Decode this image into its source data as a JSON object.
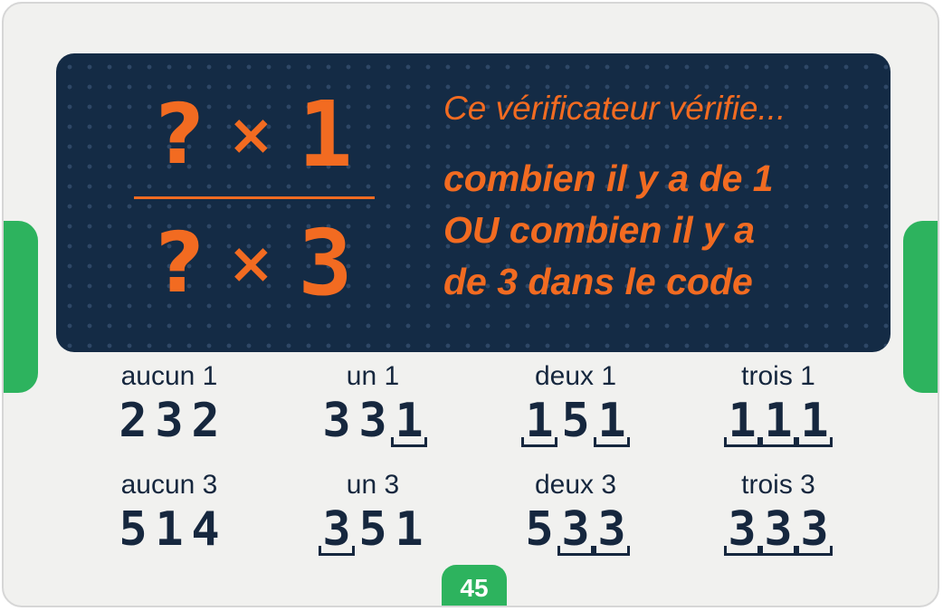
{
  "fraction": {
    "top": {
      "unknown": "?",
      "op": "×",
      "digit": "1"
    },
    "bottom": {
      "unknown": "?",
      "op": "×",
      "digit": "3"
    }
  },
  "header": {
    "intro": "Ce vérificateur vérifie...",
    "line1": "combien il y a de 1",
    "line2": "OU combien il y a",
    "line3": "de 3 dans le code"
  },
  "examples": [
    {
      "label": "aucun 1",
      "digits": [
        "2",
        "3",
        "2"
      ],
      "marked": [
        false,
        false,
        false
      ]
    },
    {
      "label": "un 1",
      "digits": [
        "3",
        "3",
        "1"
      ],
      "marked": [
        false,
        false,
        true
      ]
    },
    {
      "label": "deux 1",
      "digits": [
        "1",
        "5",
        "1"
      ],
      "marked": [
        true,
        false,
        true
      ]
    },
    {
      "label": "trois 1",
      "digits": [
        "1",
        "1",
        "1"
      ],
      "marked": [
        true,
        true,
        true
      ]
    },
    {
      "label": "aucun 3",
      "digits": [
        "5",
        "1",
        "4"
      ],
      "marked": [
        false,
        false,
        false
      ]
    },
    {
      "label": "un 3",
      "digits": [
        "3",
        "5",
        "1"
      ],
      "marked": [
        true,
        false,
        false
      ]
    },
    {
      "label": "deux 3",
      "digits": [
        "5",
        "3",
        "3"
      ],
      "marked": [
        false,
        true,
        true
      ]
    },
    {
      "label": "trois 3",
      "digits": [
        "3",
        "3",
        "3"
      ],
      "marked": [
        true,
        true,
        true
      ]
    }
  ],
  "page_number": "45",
  "colors": {
    "panel": "#142b45",
    "accent": "#f26b21",
    "tab": "#2db35e",
    "text": "#16273e"
  }
}
